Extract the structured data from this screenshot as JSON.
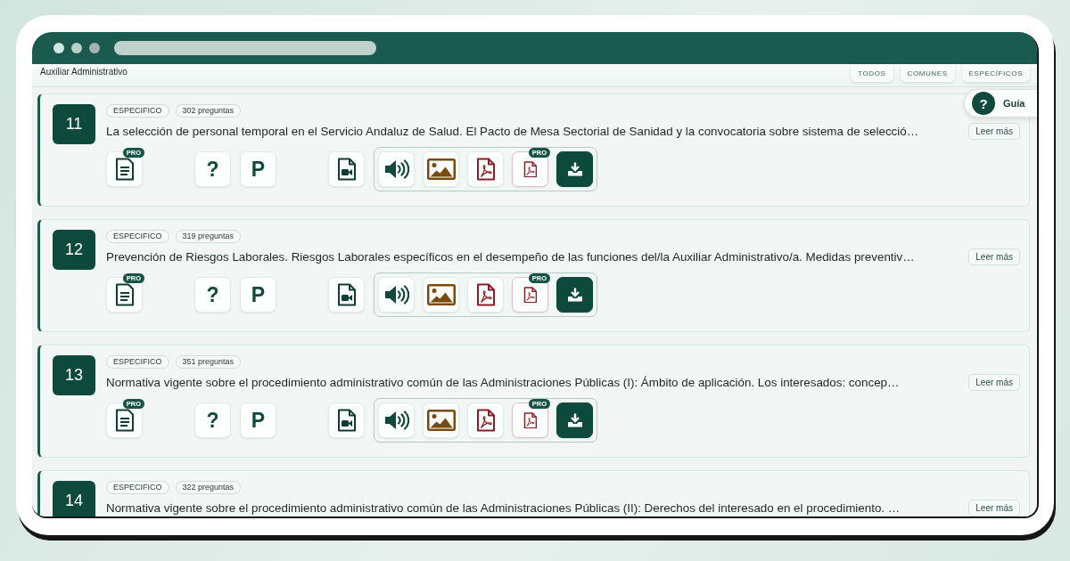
{
  "header": {
    "title": "Auxiliar Administrativo"
  },
  "filters": [
    {
      "label": "TODOS",
      "selected": false
    },
    {
      "label": "COMUNES",
      "selected": false
    },
    {
      "label": "ESPECÍFICOS",
      "selected": false
    }
  ],
  "guide_button": {
    "icon_text": "?",
    "label": "Guía"
  },
  "topics": [
    {
      "number": "11",
      "category": "ESPECIFICO",
      "questions": "302 preguntas",
      "title": "La selección de personal temporal en el Servicio Andaluz de Salud. El Pacto de Mesa Sectorial de Sanidad y la convocatoria sobre sistema de selecció…",
      "read_more": "Leer más",
      "action_groups": [
        {
          "kind": "plain",
          "items": [
            {
              "kind": "document",
              "badge": "PRO"
            }
          ]
        },
        {
          "kind": "plain",
          "items": [
            {
              "kind": "text",
              "label": "?"
            },
            {
              "kind": "text",
              "label": "P"
            }
          ]
        },
        {
          "kind": "plain",
          "items": [
            {
              "kind": "video"
            }
          ]
        },
        {
          "kind": "boxed",
          "items": [
            {
              "kind": "audio"
            },
            {
              "kind": "image"
            },
            {
              "kind": "pdf"
            },
            {
              "kind": "pdf",
              "badge": "PRO"
            },
            {
              "kind": "download"
            }
          ]
        }
      ]
    },
    {
      "number": "12",
      "category": "ESPECIFICO",
      "questions": "319 preguntas",
      "title": "Prevención de Riesgos Laborales. Riesgos Laborales específicos en el desempeño de las funciones del/la Auxiliar Administrativo/a. Medidas preventiv…",
      "read_more": "Leer más",
      "action_groups": [
        {
          "kind": "plain",
          "items": [
            {
              "kind": "document",
              "badge": "PRO"
            }
          ]
        },
        {
          "kind": "plain",
          "items": [
            {
              "kind": "text",
              "label": "?"
            },
            {
              "kind": "text",
              "label": "P"
            }
          ]
        },
        {
          "kind": "plain",
          "items": [
            {
              "kind": "video"
            }
          ]
        },
        {
          "kind": "boxed",
          "items": [
            {
              "kind": "audio"
            },
            {
              "kind": "image"
            },
            {
              "kind": "pdf"
            },
            {
              "kind": "pdf",
              "badge": "PRO"
            },
            {
              "kind": "download"
            }
          ]
        }
      ]
    },
    {
      "number": "13",
      "category": "ESPECIFICO",
      "questions": "351 preguntas",
      "title": "Normativa vigente sobre el procedimiento administrativo común de las Administraciones Públicas (I): Ámbito de aplicación. Los interesados: concep…",
      "read_more": "Leer más",
      "action_groups": [
        {
          "kind": "plain",
          "items": [
            {
              "kind": "document",
              "badge": "PRO"
            }
          ]
        },
        {
          "kind": "plain",
          "items": [
            {
              "kind": "text",
              "label": "?"
            },
            {
              "kind": "text",
              "label": "P"
            }
          ]
        },
        {
          "kind": "plain",
          "items": [
            {
              "kind": "video"
            }
          ]
        },
        {
          "kind": "boxed",
          "items": [
            {
              "kind": "audio"
            },
            {
              "kind": "image"
            },
            {
              "kind": "pdf"
            },
            {
              "kind": "pdf",
              "badge": "PRO"
            },
            {
              "kind": "download"
            }
          ]
        }
      ]
    },
    {
      "number": "14",
      "category": "ESPECIFICO",
      "questions": "322 preguntas",
      "title": "Normativa vigente sobre el procedimiento administrativo común de las Administraciones Públicas (II): Derechos del interesado en el procedimiento. …",
      "read_more": "Leer más"
    }
  ]
}
